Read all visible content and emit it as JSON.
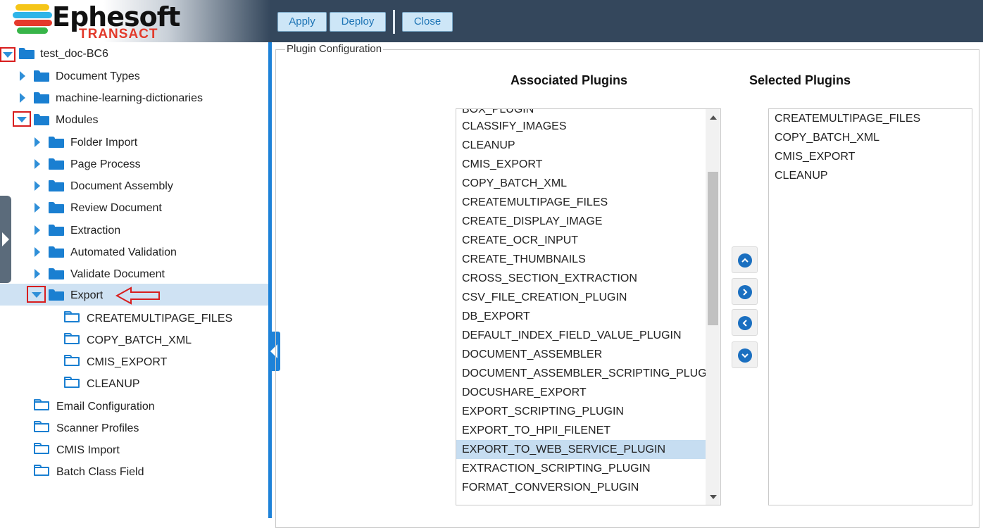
{
  "brand": {
    "name": "Ephesoft",
    "product": "TRANSACT",
    "stripe_colors": [
      "#f5c518",
      "#2fb4e8",
      "#e53a2c",
      "#38b549"
    ]
  },
  "toolbar": {
    "apply_label": "Apply",
    "deploy_label": "Deploy",
    "close_label": "Close"
  },
  "tree": {
    "root": "test_doc-BC6",
    "document_types": "Document Types",
    "ml_dictionaries": "machine-learning-dictionaries",
    "modules": "Modules",
    "module_items": [
      "Folder Import",
      "Page Process",
      "Document Assembly",
      "Review Document",
      "Extraction",
      "Automated Validation",
      "Validate Document"
    ],
    "export": "Export",
    "export_plugins": [
      "CREATEMULTIPAGE_FILES",
      "COPY_BATCH_XML",
      "CMIS_EXPORT",
      "CLEANUP"
    ],
    "other_items": [
      "Email Configuration",
      "Scanner Profiles",
      "CMIS Import",
      "Batch Class Field"
    ]
  },
  "plugin_config": {
    "legend": "Plugin Configuration",
    "associated_header": "Associated Plugins",
    "selected_header": "Selected Plugins",
    "associated_partial_top": "BOX_PLUGIN",
    "associated": [
      "CLASSIFY_IMAGES",
      "CLEANUP",
      "CMIS_EXPORT",
      "COPY_BATCH_XML",
      "CREATEMULTIPAGE_FILES",
      "CREATE_DISPLAY_IMAGE",
      "CREATE_OCR_INPUT",
      "CREATE_THUMBNAILS",
      "CROSS_SECTION_EXTRACTION",
      "CSV_FILE_CREATION_PLUGIN",
      "DB_EXPORT",
      "DEFAULT_INDEX_FIELD_VALUE_PLUGIN",
      "DOCUMENT_ASSEMBLER",
      "DOCUMENT_ASSEMBLER_SCRIPTING_PLUGIN",
      "DOCUSHARE_EXPORT",
      "EXPORT_SCRIPTING_PLUGIN",
      "EXPORT_TO_HPII_FILENET",
      "EXPORT_TO_WEB_SERVICE_PLUGIN",
      "EXTRACTION_SCRIPTING_PLUGIN",
      "FORMAT_CONVERSION_PLUGIN"
    ],
    "associated_selected": "EXPORT_TO_WEB_SERVICE_PLUGIN",
    "selected": [
      "CREATEMULTIPAGE_FILES",
      "COPY_BATCH_XML",
      "CMIS_EXPORT",
      "CLEANUP"
    ]
  },
  "icons": {
    "expanded": "triangle-down-icon",
    "collapsed": "triangle-right-icon",
    "folder": "folder-icon",
    "move_up": "chevron-up-icon",
    "move_right": "chevron-right-icon",
    "move_left": "chevron-left-icon",
    "move_down": "chevron-down-icon"
  },
  "colors": {
    "header_bg": "#34475c",
    "accent": "#1e82d8",
    "selection": "#cfe2f3",
    "highlight_red": "#d81e1e"
  }
}
